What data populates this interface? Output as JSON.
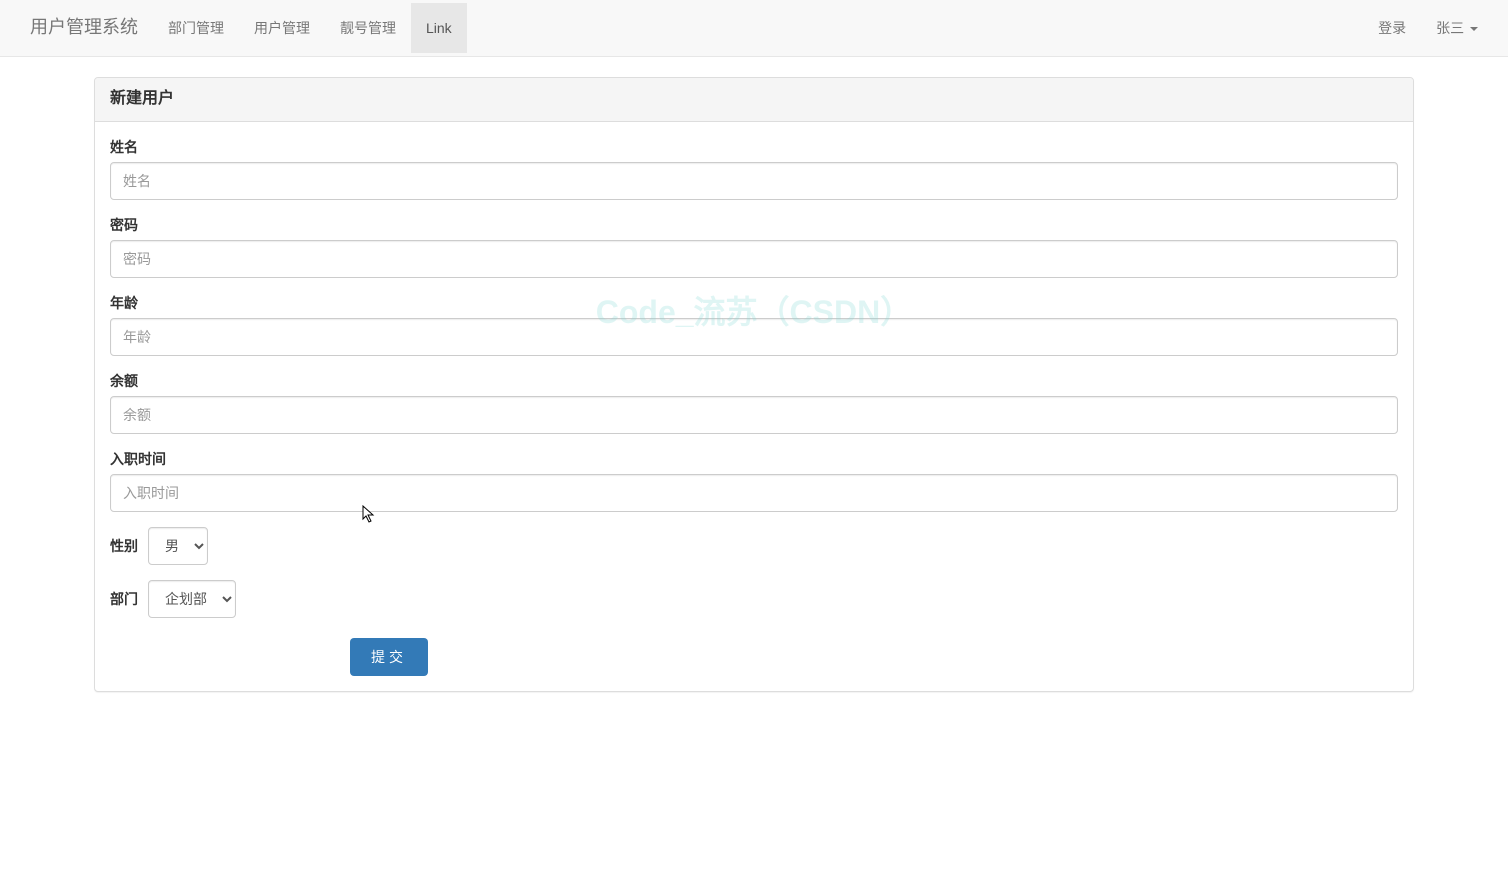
{
  "navbar": {
    "brand": "用户管理系统",
    "items": [
      {
        "label": "部门管理"
      },
      {
        "label": "用户管理"
      },
      {
        "label": "靓号管理"
      },
      {
        "label": "Link",
        "active": true
      }
    ],
    "right": {
      "login": "登录",
      "user": "张三"
    }
  },
  "panel": {
    "title": "新建用户"
  },
  "form": {
    "name": {
      "label": "姓名",
      "placeholder": "姓名"
    },
    "password": {
      "label": "密码",
      "placeholder": "密码"
    },
    "age": {
      "label": "年龄",
      "placeholder": "年龄"
    },
    "balance": {
      "label": "余额",
      "placeholder": "余额"
    },
    "hire_date": {
      "label": "入职时间",
      "placeholder": "入职时间"
    },
    "gender": {
      "label": "性别",
      "selected": "男"
    },
    "department": {
      "label": "部门",
      "selected": "企划部"
    },
    "submit": "提交"
  },
  "watermark": "Code_流苏（CSDN）"
}
